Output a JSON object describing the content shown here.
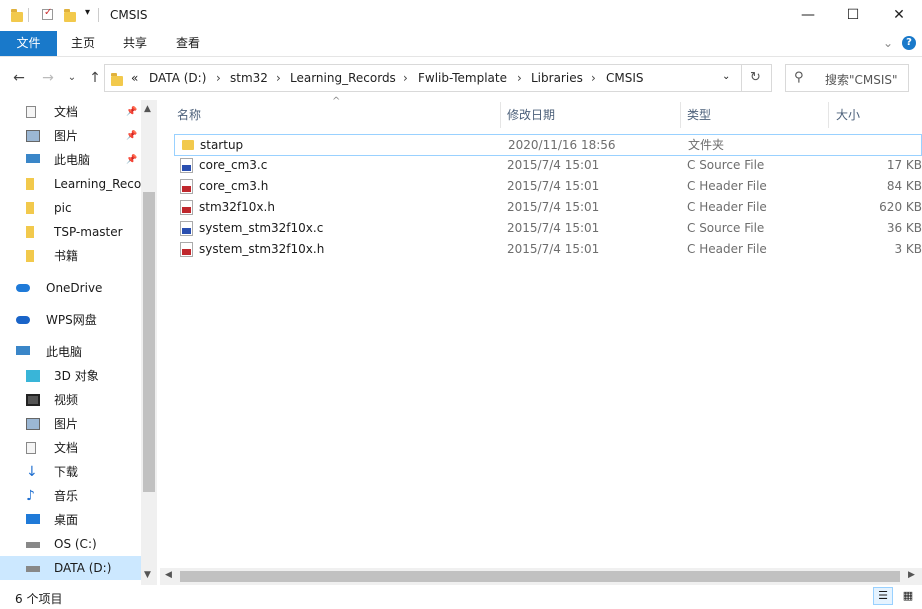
{
  "window": {
    "title": "CMSIS",
    "minimize": "—",
    "maximize": "☐",
    "close": "✕"
  },
  "ribbon": {
    "tabs": [
      "文件",
      "主页",
      "共享",
      "查看"
    ],
    "expand": "⌄",
    "help": "?"
  },
  "nav": {
    "back": "←",
    "forward": "→",
    "recent": "⌄",
    "up": "↑",
    "refresh": "↻",
    "dropdown": "⌄"
  },
  "address": {
    "overflow": "«",
    "crumbs": [
      "DATA (D:)",
      "stm32",
      "Learning_Records",
      "Fwlib-Template",
      "Libraries",
      "CMSIS"
    ],
    "sep": "›"
  },
  "search": {
    "placeholder": "搜索\"CMSIS\""
  },
  "sidebar": {
    "items": [
      {
        "label": "文档",
        "icon": "documents-icon",
        "pinned": true
      },
      {
        "label": "图片",
        "icon": "pictures-icon",
        "pinned": true
      },
      {
        "label": "此电脑",
        "icon": "computer-icon",
        "pinned": true
      },
      {
        "label": "Learning_Records",
        "icon": "folder-icon",
        "pinned": false
      },
      {
        "label": "pic",
        "icon": "folder-icon",
        "pinned": false
      },
      {
        "label": "TSP-master",
        "icon": "folder-icon",
        "pinned": false
      },
      {
        "label": "书籍",
        "icon": "folder-icon",
        "pinned": false
      },
      {
        "label": "OneDrive",
        "icon": "onedrive-icon",
        "pinned": false
      },
      {
        "label": "WPS网盘",
        "icon": "wps-cloud-icon",
        "pinned": false
      },
      {
        "label": "此电脑",
        "icon": "computer-icon",
        "pinned": false
      },
      {
        "label": "3D 对象",
        "icon": "3d-objects-icon",
        "pinned": false
      },
      {
        "label": "视频",
        "icon": "videos-icon",
        "pinned": false
      },
      {
        "label": "图片",
        "icon": "pictures-icon",
        "pinned": false
      },
      {
        "label": "文档",
        "icon": "documents-icon",
        "pinned": false
      },
      {
        "label": "下载",
        "icon": "downloads-icon",
        "pinned": false
      },
      {
        "label": "音乐",
        "icon": "music-icon",
        "pinned": false
      },
      {
        "label": "桌面",
        "icon": "desktop-icon",
        "pinned": false
      },
      {
        "label": "OS (C:)",
        "icon": "drive-icon",
        "pinned": false
      },
      {
        "label": "DATA (D:)",
        "icon": "drive-icon",
        "pinned": false
      }
    ],
    "pin_glyph": "📌"
  },
  "columns": {
    "name": "名称",
    "date": "修改日期",
    "type": "类型",
    "size": "大小",
    "sort": "^"
  },
  "files": [
    {
      "name": "startup",
      "date": "2020/11/16 18:56",
      "type": "文件夹",
      "size": "",
      "kind": "folder"
    },
    {
      "name": "core_cm3.c",
      "date": "2015/7/4 15:01",
      "type": "C Source File",
      "size": "17 KB",
      "kind": "c"
    },
    {
      "name": "core_cm3.h",
      "date": "2015/7/4 15:01",
      "type": "C Header File",
      "size": "84 KB",
      "kind": "h"
    },
    {
      "name": "stm32f10x.h",
      "date": "2015/7/4 15:01",
      "type": "C Header File",
      "size": "620 KB",
      "kind": "h"
    },
    {
      "name": "system_stm32f10x.c",
      "date": "2015/7/4 15:01",
      "type": "C Source File",
      "size": "36 KB",
      "kind": "c"
    },
    {
      "name": "system_stm32f10x.h",
      "date": "2015/7/4 15:01",
      "type": "C Header File",
      "size": "3 KB",
      "kind": "h"
    }
  ],
  "status": {
    "count": "6 个项目"
  },
  "colors": {
    "accent": "#1979ca",
    "selected": "#cce8ff",
    "c_band": "#2a4fb0",
    "h_band": "#c0282d",
    "folder": "#f2c94c"
  }
}
